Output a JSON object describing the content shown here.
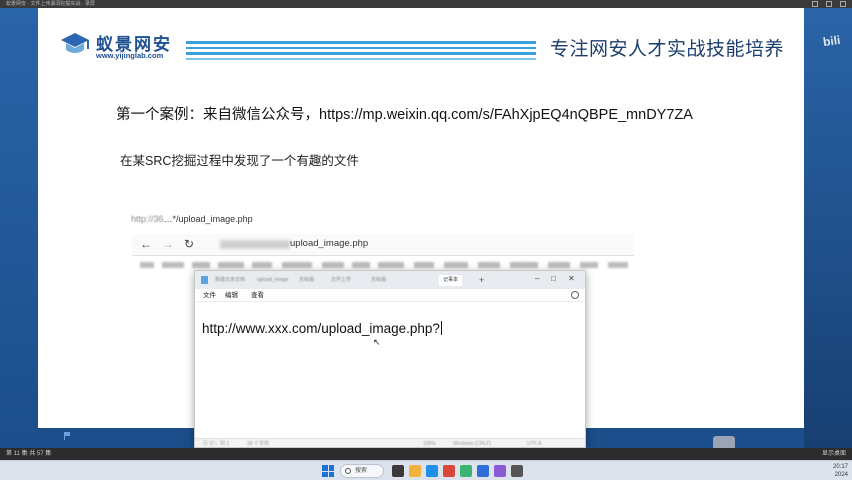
{
  "recorder": {
    "title": "蚁景网安 · 文件上传漏洞挖掘实战 · 录屏",
    "status_left": "第 11 集  共 57 集",
    "status_right": "显示桌面",
    "watermark": "bili"
  },
  "slide": {
    "logo": {
      "title": "蚁景网安",
      "url": "www.yijinglab.com"
    },
    "slogan": "专注网安人才实战技能培养",
    "case_line": "第一个案例：来自微信公众号，https://mp.weixin.qq.com/s/FAhXjpEQ4nQBPE_mnDY7ZA",
    "finding_line": "在某SRC挖掘过程中发现了一个有趣的文件",
    "caption_url": {
      "prefix": "http://36",
      "suffix": "…*/upload_image.php"
    }
  },
  "browser": {
    "back_icon": "←",
    "forward_icon": "→",
    "reload_icon": "↻",
    "address_suffix": "upload_image.php"
  },
  "notepad": {
    "tabs": [
      "新建文本文档",
      "upload_image",
      "无标题",
      "文件上传",
      "无标题",
      "记事本"
    ],
    "new_tab": "+",
    "menu": [
      "文件",
      "编辑",
      "查看"
    ],
    "content": "http://www.xxx.com/upload_image.php?",
    "status": [
      "行 37，列 1",
      "38 个字符",
      "100%",
      "Windows (CRLF)",
      "UTF-8"
    ]
  },
  "taskbar": {
    "search_placeholder": "搜索",
    "time": "20:17",
    "date": "2024"
  }
}
